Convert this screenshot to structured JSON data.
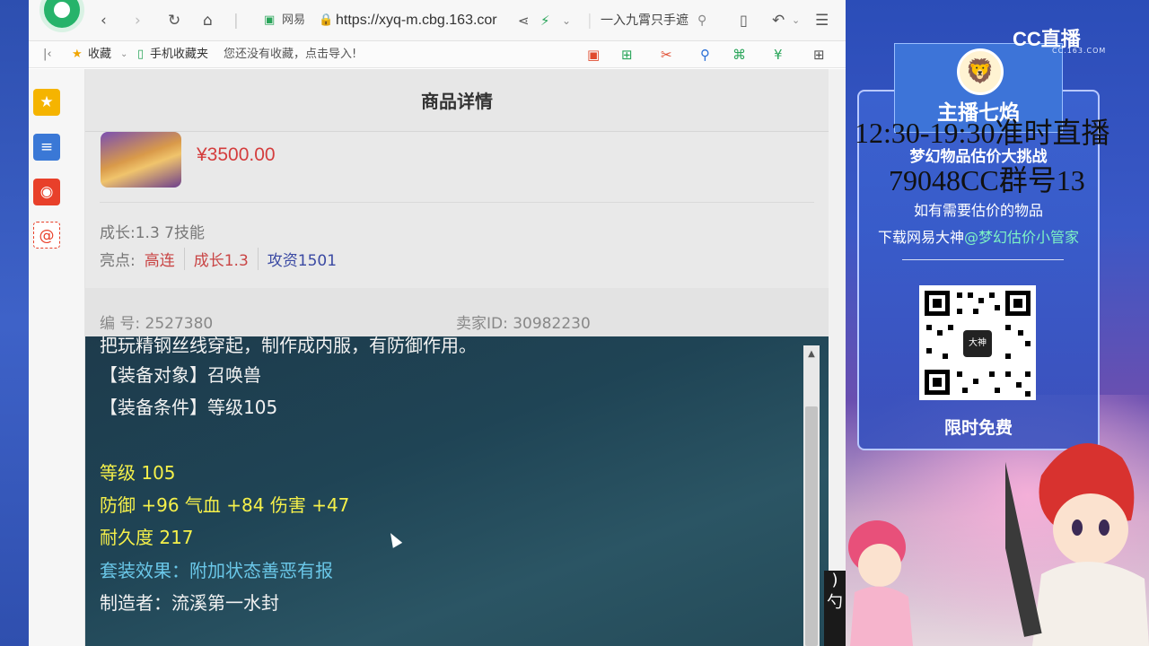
{
  "browser": {
    "brand": "网易",
    "url": "https://xyq-m.cbg.163.cor",
    "search_placeholder": "一入九霄只手遮",
    "bookmarks_label": "收藏",
    "mobile_bookmarks": "手机收藏夹",
    "no_bookmarks_text": "您还没有收藏，点击导入!"
  },
  "page": {
    "title": "商品详情",
    "price": "¥3500.00",
    "growth_skills": "成长:1.3 7技能",
    "highlights_label": "亮点:",
    "highlights": [
      "高连",
      "成长1.3",
      "攻资1501"
    ],
    "code_no": "编 号: 2527380",
    "seller_id": "卖家ID: 30982230"
  },
  "equip": {
    "partial_line": "把玩精钢丝线穿起，制作成内服，有防御作用。",
    "target": "【装备对象】召唤兽",
    "condition": "【装备条件】等级105",
    "level": "等级 105",
    "stats": "防御 +96 气血 +84 伤害 +47",
    "durability": "耐久度 217",
    "set_effect": "套装效果：附加状态善恶有报",
    "maker": "制造者：流溪第一水封"
  },
  "stream": {
    "cc_logo": "CC直播",
    "cc_domain": "CC.163.COM",
    "anchor_name": "主播七焰",
    "schedule": "12:30-19:30准时直播",
    "event_title": "梦幻物品估价大挑战",
    "group_no": "79048CC群号13",
    "need_text": "如有需要估价的物品",
    "download_prefix": "下载网易大神",
    "download_handle": "@梦幻估价小管家",
    "qr_center": "大神",
    "free_label": "限时免费"
  },
  "colors": {
    "price_red": "#d43d3d",
    "equip_yellow": "#f5f04a",
    "equip_cyan": "#6ac7e8",
    "stream_blue": "#3d74d8"
  }
}
